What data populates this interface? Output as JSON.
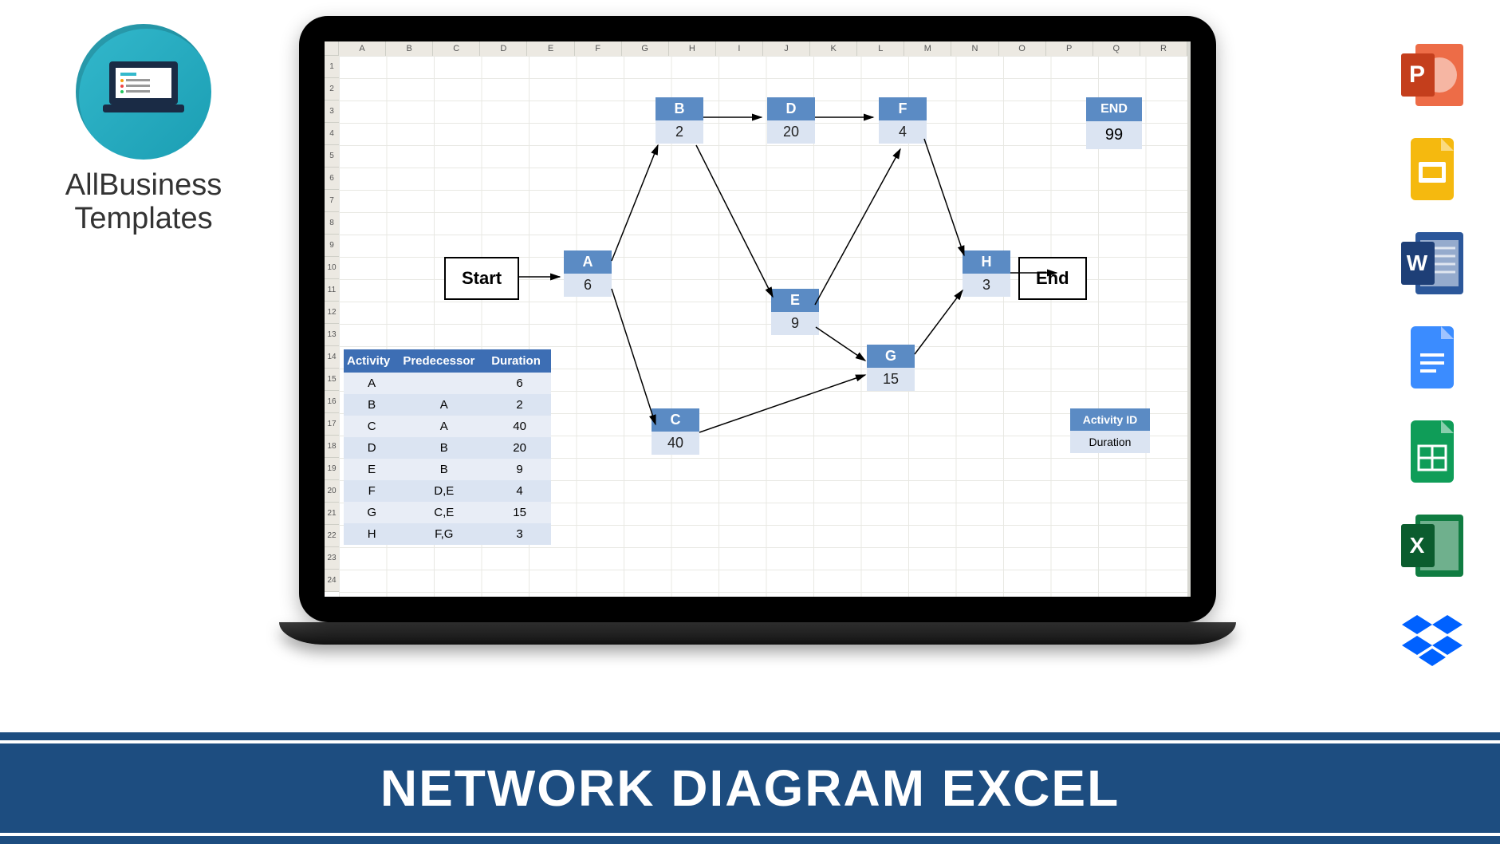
{
  "logo": {
    "line1": "AllBusiness",
    "line2": "Templates"
  },
  "banner": "NETWORK DIAGRAM EXCEL",
  "sheet": {
    "columns": [
      "A",
      "B",
      "C",
      "D",
      "E",
      "F",
      "G",
      "H",
      "I",
      "J",
      "K",
      "L",
      "M",
      "N",
      "O",
      "P",
      "Q",
      "R"
    ],
    "rows": [
      "1",
      "2",
      "3",
      "4",
      "5",
      "6",
      "7",
      "8",
      "9",
      "10",
      "11",
      "12",
      "13",
      "14",
      "15",
      "16",
      "17",
      "18",
      "19",
      "20",
      "21",
      "22",
      "23",
      "24"
    ]
  },
  "table": {
    "headers": [
      "Activity",
      "Predecessor",
      "Duration"
    ],
    "rows": [
      [
        "A",
        "",
        "6"
      ],
      [
        "B",
        "A",
        "2"
      ],
      [
        "C",
        "A",
        "40"
      ],
      [
        "D",
        "B",
        "20"
      ],
      [
        "E",
        "B",
        "9"
      ],
      [
        "F",
        "D,E",
        "4"
      ],
      [
        "G",
        "C,E",
        "15"
      ],
      [
        "H",
        "F,G",
        "3"
      ]
    ]
  },
  "diagram": {
    "start": "Start",
    "end": "End",
    "nodes": {
      "A": "6",
      "B": "2",
      "C": "40",
      "D": "20",
      "E": "9",
      "F": "4",
      "G": "15",
      "H": "3"
    },
    "end_stat": {
      "label": "END",
      "value": "99"
    },
    "legend": {
      "top": "Activity ID",
      "bottom": "Duration"
    }
  },
  "apps": [
    "powerpoint",
    "google-slides",
    "word",
    "google-docs",
    "google-sheets",
    "excel",
    "dropbox"
  ]
}
